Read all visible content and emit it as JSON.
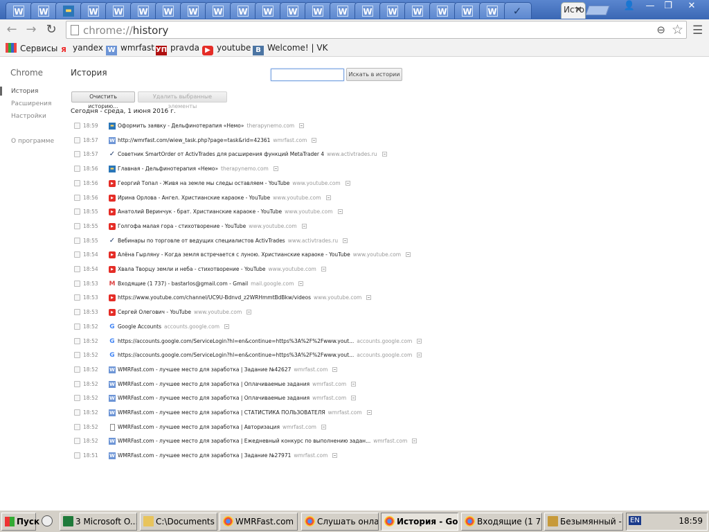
{
  "tabs": {
    "generic_title": "W",
    "active_title": "История",
    "close_glyph": "✕"
  },
  "window": {
    "minimize": "—",
    "restore": "❐",
    "close": "✕"
  },
  "toolbar": {
    "url_scheme": "chrome://",
    "url_path": "history"
  },
  "bookmarks": [
    {
      "label": "Сервисы",
      "icon": "apps-icon"
    },
    {
      "label": "yandex",
      "icon": "yandex-icon"
    },
    {
      "label": "wmrfast",
      "icon": "wmrfast-icon"
    },
    {
      "label": "pravda",
      "icon": "pravda-icon"
    },
    {
      "label": "youtube",
      "icon": "youtube-icon"
    },
    {
      "label": "Welcome! | VK",
      "icon": "vk-icon"
    }
  ],
  "sidebar": {
    "brand": "Chrome",
    "items": [
      {
        "label": "История"
      },
      {
        "label": "Расширения"
      },
      {
        "label": "Настройки"
      },
      {
        "label": "О программе"
      }
    ]
  },
  "page": {
    "title": "История",
    "search_button": "Искать в истории",
    "clear_button": "Очистить историю...",
    "remove_button": "Удалить выбранные элементы",
    "day_header": "Сегодня - среда, 1 июня 2016 г."
  },
  "history": [
    {
      "time": "18:59",
      "icon": "img",
      "title": "Оформить заявку - Дельфинотерапия «Немо»",
      "domain": "therapynemo.com"
    },
    {
      "time": "18:57",
      "icon": "w",
      "title": "http://wmrfast.com/wiew_task.php?page=task&rid=42361",
      "domain": "wmrfast.com"
    },
    {
      "time": "18:57",
      "icon": "chk",
      "title": "Советник SmartOrder от ActivTrades для расширения функций MetaTrader 4",
      "domain": "www.activtrades.ru"
    },
    {
      "time": "18:56",
      "icon": "img",
      "title": "Главная - Дельфинотерапия «Немо»",
      "domain": "therapynemo.com"
    },
    {
      "time": "18:56",
      "icon": "yt",
      "title": "Георгий Топал - Живя на земле мы следы оставляем - YouTube",
      "domain": "www.youtube.com"
    },
    {
      "time": "18:56",
      "icon": "yt",
      "title": "Ирина Орлова - Ангел. Христианские караоке - YouTube",
      "domain": "www.youtube.com"
    },
    {
      "time": "18:55",
      "icon": "yt",
      "title": "Анатолий Веринчук - брат. Христианские караоке - YouTube",
      "domain": "www.youtube.com"
    },
    {
      "time": "18:55",
      "icon": "yt",
      "title": "Голгофа малая гора - стихотворение - YouTube",
      "domain": "www.youtube.com"
    },
    {
      "time": "18:55",
      "icon": "chk",
      "title": "Вебинары по торговле от ведущих специалистов ActivTrades",
      "domain": "www.activtrades.ru"
    },
    {
      "time": "18:54",
      "icon": "yt",
      "title": "Алёна Гырляну - Когда земля встречается с луною. Христианские караоке - YouTube",
      "domain": "www.youtube.com"
    },
    {
      "time": "18:54",
      "icon": "yt",
      "title": "Хвала Творцу земли и неба - стихотворение - YouTube",
      "domain": "www.youtube.com"
    },
    {
      "time": "18:53",
      "icon": "gm",
      "title": "Входящие (1 737) - bastarlos@gmail.com - Gmail",
      "domain": "mail.google.com"
    },
    {
      "time": "18:53",
      "icon": "yt",
      "title": "https://www.youtube.com/channel/UC9U-Bdnvd_z2WRHmmtBdBkw/videos",
      "domain": "www.youtube.com"
    },
    {
      "time": "18:53",
      "icon": "yt",
      "title": "Сергей Олегович - YouTube",
      "domain": "www.youtube.com"
    },
    {
      "time": "18:52",
      "icon": "g",
      "title": "Google Accounts",
      "domain": "accounts.google.com"
    },
    {
      "time": "18:52",
      "icon": "g",
      "title": "https://accounts.google.com/ServiceLogin?hl=en&continue=https%3A%2F%2Fwww.yout...",
      "domain": "accounts.google.com"
    },
    {
      "time": "18:52",
      "icon": "g",
      "title": "https://accounts.google.com/ServiceLogin?hl=en&continue=https%3A%2F%2Fwww.yout...",
      "domain": "accounts.google.com"
    },
    {
      "time": "18:52",
      "icon": "w",
      "title": "WMRFast.com - лучшее место для заработка | Задание №42627",
      "domain": "wmrfast.com"
    },
    {
      "time": "18:52",
      "icon": "w",
      "title": "WMRFast.com - лучшее место для заработка | Оплачиваемые задания",
      "domain": "wmrfast.com"
    },
    {
      "time": "18:52",
      "icon": "w",
      "title": "WMRFast.com - лучшее место для заработка | Оплачиваемые задания",
      "domain": "wmrfast.com"
    },
    {
      "time": "18:52",
      "icon": "w",
      "title": "WMRFast.com - лучшее место для заработка | СТАТИСТИКА ПОЛЬЗОВАТЕЛЯ",
      "domain": "wmrfast.com"
    },
    {
      "time": "18:52",
      "icon": "page",
      "title": "WMRFast.com - лучшее место для заработка | Авторизация",
      "domain": "wmrfast.com"
    },
    {
      "time": "18:52",
      "icon": "w",
      "title": "WMRFast.com - лучшее место для заработка | Ежедневный конкурс по выполнению задан...",
      "domain": "wmrfast.com"
    },
    {
      "time": "18:51",
      "icon": "w",
      "title": "WMRFast.com - лучшее место для заработка | Задание №27971",
      "domain": "wmrfast.com"
    }
  ],
  "taskbar": {
    "start": "Пуск",
    "items": [
      {
        "label": "3 Microsoft O...",
        "icon": "xl"
      },
      {
        "label": "C:\\Documents ...",
        "icon": "fold"
      },
      {
        "label": "WMRFast.com ...",
        "icon": "chrome"
      },
      {
        "label": "Слушать онла...",
        "icon": "chrome"
      },
      {
        "label": "История - Go...",
        "icon": "chrome",
        "active": true
      },
      {
        "label": "Входящие (1 7...",
        "icon": "chrome"
      },
      {
        "label": "Безымянный - ...",
        "icon": "pt"
      }
    ],
    "lang": "EN",
    "clock": "18:59"
  }
}
